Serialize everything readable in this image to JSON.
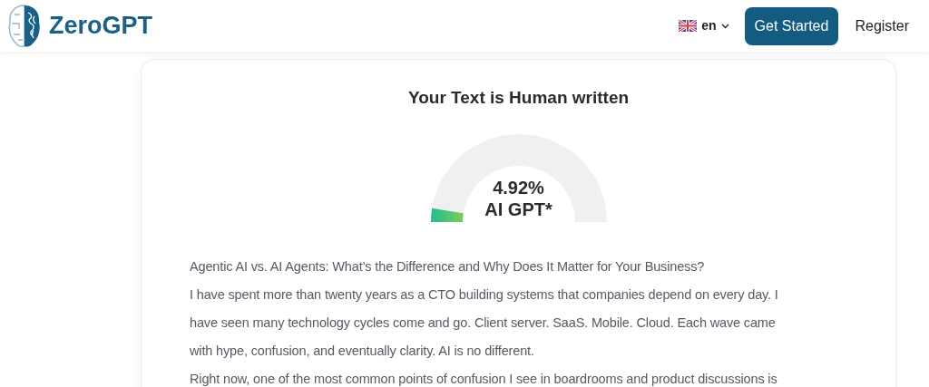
{
  "header": {
    "logo_text": "ZeroGPT",
    "language": "en",
    "get_started": "Get Started",
    "register": "Register"
  },
  "result": {
    "title": "Your Text is Human written",
    "gauge": {
      "percent": "4.92%",
      "label": "AI GPT*"
    }
  },
  "paragraphs": [
    "Agentic AI vs. AI Agents: What’s the Difference and Why Does It Matter for Your Business?",
    "I have spent more than twenty years as a CTO building systems that companies depend on every day. I have seen many technology cycles come and go. Client server. SaaS. Mobile. Cloud. Each wave came with hype, confusion, and eventually clarity. AI is no different.",
    "Right now, one of the most common points of confusion I see in boardrooms and product discussions is"
  ]
}
